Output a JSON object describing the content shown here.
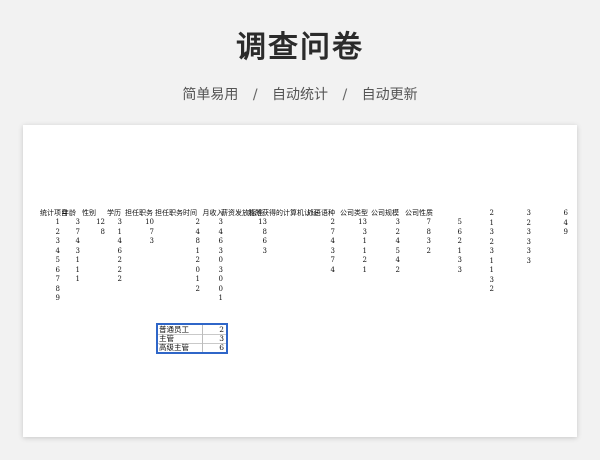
{
  "page": {
    "title": "调查问卷",
    "features": [
      "简单易用",
      "自动统计",
      "自动更新"
    ],
    "separator": "/"
  },
  "sheet": {
    "headers": [
      "统计项目",
      "年龄",
      "性别",
      "学历",
      "担任职务",
      "担任职务时间",
      "月收入",
      "薪资发放标准",
      "能所获得的计算机认证",
      "外语语种",
      "公司类型",
      "公司规模",
      "公司性质"
    ],
    "row_index": [
      "1",
      "2",
      "3",
      "4",
      "5",
      "6",
      "7",
      "8",
      "9"
    ],
    "columns": [
      [
        "3",
        "7",
        "4",
        "3",
        "1",
        "1",
        "1"
      ],
      [
        "12",
        "8"
      ],
      [
        "3",
        "1",
        "4",
        "6",
        "2",
        "2",
        "2"
      ],
      [
        "10",
        "7",
        "3"
      ],
      [
        "2",
        "4",
        "8",
        "1",
        "2",
        "0",
        "1",
        "2"
      ],
      [
        "3",
        "4",
        "6",
        "3",
        "0",
        "3",
        "0",
        "0",
        "1"
      ],
      [
        "13",
        "8",
        "6",
        "3"
      ],
      [
        "2",
        "7",
        "4",
        "3",
        "7",
        "4"
      ],
      [
        "13",
        "3",
        "1",
        "1",
        "2",
        "1"
      ],
      [
        "3",
        "2",
        "4",
        "5",
        "4",
        "2"
      ],
      [
        "7",
        "8",
        "3",
        "2"
      ],
      [
        "5",
        "6",
        "2",
        "1",
        "3",
        "3"
      ]
    ],
    "right_columns": [
      [
        "2",
        "1",
        "3",
        "2",
        "3",
        "1",
        "1",
        "3",
        "2"
      ],
      [
        "3",
        "2",
        "3",
        "3",
        "3",
        "3"
      ],
      [
        "6",
        "4",
        "9"
      ]
    ],
    "summary": [
      {
        "label": "普通员工",
        "value": "2"
      },
      {
        "label": "主管",
        "value": "3"
      },
      {
        "label": "高级主管",
        "value": "6"
      }
    ]
  },
  "colors": {
    "accent": "#2f66c8",
    "background": "#f2f2f2"
  }
}
